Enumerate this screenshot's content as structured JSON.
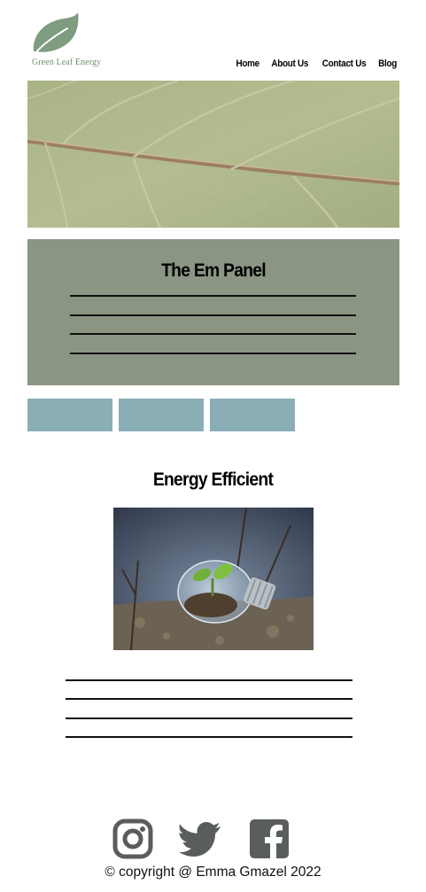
{
  "brand": {
    "name": "Green Leaf Energy",
    "color": "#6f8f72"
  },
  "nav": {
    "items": [
      {
        "label": "Home"
      },
      {
        "label": "About Us"
      },
      {
        "label": "Contact Us"
      },
      {
        "label": "Blog"
      }
    ]
  },
  "hero": {
    "image": "leaf-closeup"
  },
  "panel": {
    "title": "The Em Panel",
    "background": "#8a9583"
  },
  "tabs": {
    "color": "#8aaeb5",
    "count": 3
  },
  "energy": {
    "title": "Energy Efficient",
    "image": "lightbulb-with-sprout"
  },
  "footer": {
    "social": [
      {
        "icon": "instagram-icon"
      },
      {
        "icon": "twitter-icon"
      },
      {
        "icon": "facebook-icon"
      }
    ],
    "icon_color": "#5a5e5a",
    "copyright": "© copyright @ Emma Gmazel 2022"
  }
}
